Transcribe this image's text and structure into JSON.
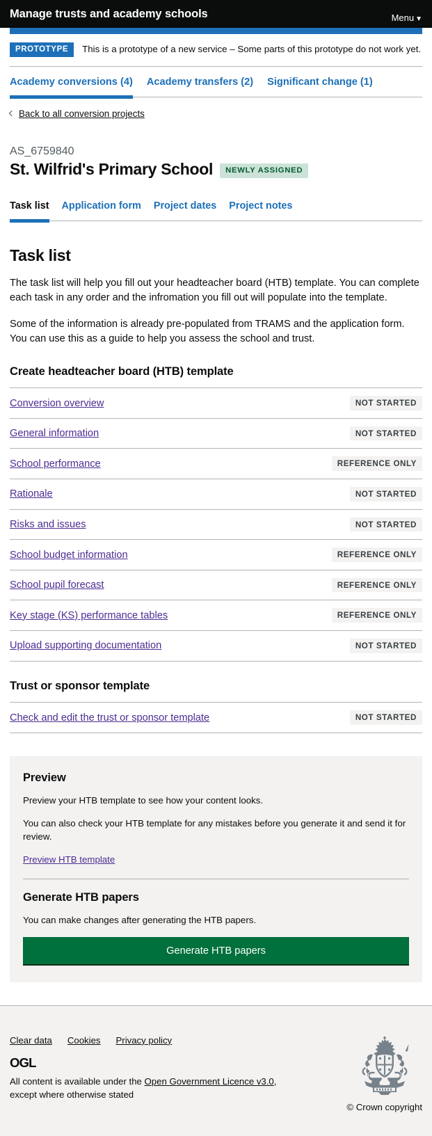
{
  "header": {
    "service_name": "Manage trusts and academy schools",
    "menu_label": "Menu",
    "menu_caret": "▼",
    "accent_blue": "#1d70b8",
    "background": "#0b0c0c"
  },
  "phase_banner": {
    "tag": "PROTOTYPE",
    "text": "This is a prototype of a new service – Some parts of this prototype do not work yet."
  },
  "primary_nav": {
    "items": [
      {
        "label": "Academy conversions (4)",
        "current": true
      },
      {
        "label": "Academy transfers (2)",
        "current": false
      },
      {
        "label": "Significant change (1)",
        "current": false
      }
    ]
  },
  "back_link": {
    "label": "Back to all conversion projects",
    "icon": "chevron-left-icon"
  },
  "project": {
    "reference": "AS_6759840",
    "name": "St. Wilfrid's Primary School",
    "status_tag": "NEWLY ASSIGNED",
    "status_tag_bg": "#cce2d8",
    "status_tag_color": "#005a30"
  },
  "sub_nav": {
    "items": [
      {
        "label": "Task list",
        "current": true
      },
      {
        "label": "Application form",
        "current": false
      },
      {
        "label": "Project dates",
        "current": false
      },
      {
        "label": "Project notes",
        "current": false
      }
    ]
  },
  "main": {
    "heading": "Task list",
    "paragraph_1": "The task list will help you fill out your headteacher board (HTB) template. You can complete each task in any order and the infromation you fill out will populate into the template.",
    "paragraph_2": "Some of the information is already pre-populated from TRAMS and the application form. You can use this as a guide to help you assess the school and trust.",
    "htb_section_heading": "Create headteacher board (HTB) template",
    "htb_tasks": [
      {
        "label": "Conversion overview",
        "status": "NOT STARTED"
      },
      {
        "label": "General information",
        "status": "NOT STARTED"
      },
      {
        "label": "School performance",
        "status": "REFERENCE ONLY"
      },
      {
        "label": "Rationale",
        "status": "NOT STARTED"
      },
      {
        "label": "Risks and issues",
        "status": "NOT STARTED"
      },
      {
        "label": "School budget information",
        "status": "REFERENCE ONLY"
      },
      {
        "label": "School pupil forecast",
        "status": "REFERENCE ONLY"
      },
      {
        "label": "Key stage (KS) performance tables",
        "status": "REFERENCE ONLY"
      },
      {
        "label": "Upload supporting documentation",
        "status": "NOT STARTED"
      }
    ],
    "trust_section_heading": "Trust or sponsor template",
    "trust_tasks": [
      {
        "label": "Check and edit the trust or sponsor template",
        "status": "NOT STARTED"
      }
    ]
  },
  "preview_panel": {
    "heading": "Preview",
    "paragraph_1": "Preview your HTB template to see how your content looks.",
    "paragraph_2": "You can also check your HTB template for any mistakes before you generate it and send it for review.",
    "link_label": "Preview HTB template",
    "generate_heading": "Generate HTB papers",
    "generate_paragraph": "You can make changes after generating the HTB papers.",
    "generate_button_label": "Generate HTB papers",
    "button_color": "#00703c"
  },
  "footer": {
    "links": [
      {
        "label": "Clear data"
      },
      {
        "label": "Cookies"
      },
      {
        "label": "Privacy policy"
      }
    ],
    "ogl_logo_text": "OGL",
    "licence_prefix": "All content is available under the ",
    "licence_link": "Open Government Licence v3.0",
    "licence_suffix": ", except where otherwise stated",
    "crown_copyright": "© Crown copyright"
  }
}
